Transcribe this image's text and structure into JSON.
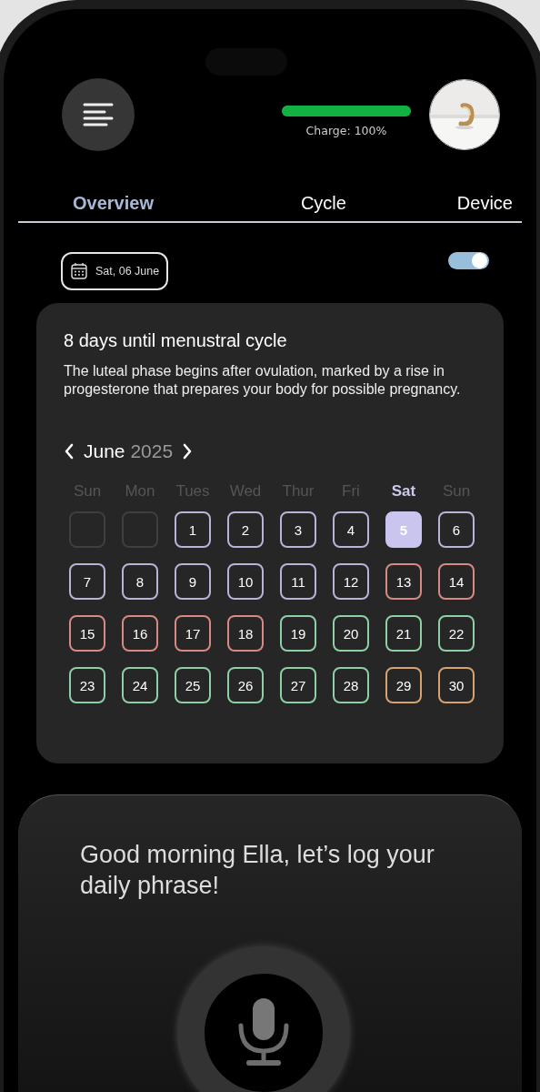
{
  "header": {
    "charge": {
      "level": 1,
      "label": "Charge: 100%"
    }
  },
  "tabs": [
    {
      "label": "Overview",
      "selected": true
    },
    {
      "label": "Cycle",
      "selected": false
    },
    {
      "label": "Device",
      "selected": false
    }
  ],
  "date_chip": {
    "label": "Sat, 06 June"
  },
  "toggle": {
    "on": true
  },
  "cycle_card": {
    "title": "8 days until menustral cycle",
    "description": "The luteal phase begins after ovulation, marked by a rise in progesterone that prepares your body for possible pregnancy.",
    "calendar": {
      "month": "June",
      "year": "2025",
      "weekdays": [
        {
          "label": "Sun",
          "highlighted": false
        },
        {
          "label": "Mon",
          "highlighted": false
        },
        {
          "label": "Tues",
          "highlighted": false
        },
        {
          "label": "Wed",
          "highlighted": false
        },
        {
          "label": "Thur",
          "highlighted": false
        },
        {
          "label": "Fri",
          "highlighted": false
        },
        {
          "label": "Sat",
          "highlighted": true
        },
        {
          "label": "Sun",
          "highlighted": false
        }
      ],
      "cells": [
        {
          "kind": "blank"
        },
        {
          "kind": "blank"
        },
        {
          "kind": "day",
          "label": "1",
          "color": "#b8b3d8",
          "selected": false
        },
        {
          "kind": "day",
          "label": "2",
          "color": "#b8b3d8",
          "selected": false
        },
        {
          "kind": "day",
          "label": "3",
          "color": "#b8b3d8",
          "selected": false
        },
        {
          "kind": "day",
          "label": "4",
          "color": "#b8b3d8",
          "selected": false
        },
        {
          "kind": "day",
          "label": "5",
          "color": "#c9c5ee",
          "selected": true
        },
        {
          "kind": "day",
          "label": "6",
          "color": "#b8b3d8",
          "selected": false
        },
        {
          "kind": "day",
          "label": "7",
          "color": "#b8b3d8",
          "selected": false
        },
        {
          "kind": "day",
          "label": "8",
          "color": "#b8b3d8",
          "selected": false
        },
        {
          "kind": "day",
          "label": "9",
          "color": "#b8b3d8",
          "selected": false
        },
        {
          "kind": "day",
          "label": "10",
          "color": "#b8b3d8",
          "selected": false
        },
        {
          "kind": "day",
          "label": "11",
          "color": "#b8b3d8",
          "selected": false
        },
        {
          "kind": "day",
          "label": "12",
          "color": "#b8b3d8",
          "selected": false
        },
        {
          "kind": "day",
          "label": "13",
          "color": "#d98884",
          "selected": false
        },
        {
          "kind": "day",
          "label": "14",
          "color": "#d98884",
          "selected": false
        },
        {
          "kind": "day",
          "label": "15",
          "color": "#d98884",
          "selected": false
        },
        {
          "kind": "day",
          "label": "16",
          "color": "#d98884",
          "selected": false
        },
        {
          "kind": "day",
          "label": "17",
          "color": "#d98884",
          "selected": false
        },
        {
          "kind": "day",
          "label": "18",
          "color": "#d98884",
          "selected": false
        },
        {
          "kind": "day",
          "label": "19",
          "color": "#8ecfa6",
          "selected": false
        },
        {
          "kind": "day",
          "label": "20",
          "color": "#8ecfa6",
          "selected": false
        },
        {
          "kind": "day",
          "label": "21",
          "color": "#8ecfa6",
          "selected": false
        },
        {
          "kind": "day",
          "label": "22",
          "color": "#8ecfa6",
          "selected": false
        },
        {
          "kind": "day",
          "label": "23",
          "color": "#8ecfa6",
          "selected": false
        },
        {
          "kind": "day",
          "label": "24",
          "color": "#8ecfa6",
          "selected": false
        },
        {
          "kind": "day",
          "label": "25",
          "color": "#8ecfa6",
          "selected": false
        },
        {
          "kind": "day",
          "label": "26",
          "color": "#8ecfa6",
          "selected": false
        },
        {
          "kind": "day",
          "label": "27",
          "color": "#8ecfa6",
          "selected": false
        },
        {
          "kind": "day",
          "label": "28",
          "color": "#8ecfa6",
          "selected": false
        },
        {
          "kind": "day",
          "label": "29",
          "color": "#d6a26e",
          "selected": false
        },
        {
          "kind": "day",
          "label": "30",
          "color": "#d6a26e",
          "selected": false
        }
      ]
    }
  },
  "voice_sheet": {
    "greeting": "Good morning Ella, let’s log your daily phrase!"
  }
}
